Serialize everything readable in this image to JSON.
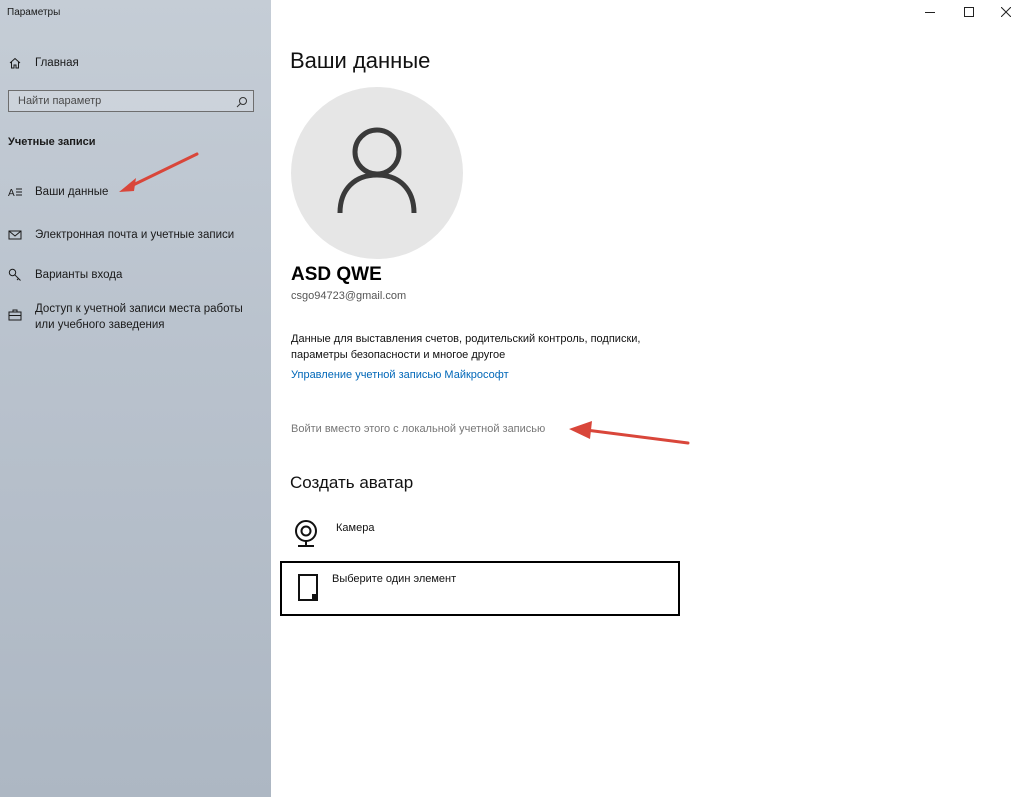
{
  "window": {
    "title": "Параметры",
    "controls": [
      "minimize-icon",
      "maximize-icon",
      "close-icon"
    ]
  },
  "sidebar": {
    "home": {
      "label": "Главная",
      "icon": "home-icon"
    },
    "search": {
      "placeholder": "Найти параметр",
      "value": "",
      "icon": "search-icon"
    },
    "section_heading": "Учетные записи",
    "items": [
      {
        "label": "Ваши данные",
        "icon": "person-info-icon",
        "selected": true
      },
      {
        "label": "Электронная почта и учетные записи",
        "icon": "mail-icon"
      },
      {
        "label": "Варианты входа",
        "icon": "key-icon"
      },
      {
        "label": "Доступ к учетной записи места работы или учебного заведения",
        "icon": "briefcase-icon"
      }
    ]
  },
  "main": {
    "title": "Ваши данные",
    "avatar_icon": "person-icon",
    "user": {
      "name": "ASD QWE",
      "email": "csgo94723@gmail.com"
    },
    "description": "Данные для выставления счетов, родительский контроль, подписки, параметры безопасности и многое другое",
    "manage_link": "Управление учетной записью Майкрософт",
    "local_link": "Войти вместо этого с локальной учетной записью",
    "avatar_section": {
      "heading": "Создать аватар",
      "options": [
        {
          "label": "Камера",
          "icon": "camera-icon"
        },
        {
          "label": "Выберите один элемент",
          "icon": "file-icon"
        }
      ]
    }
  },
  "colors": {
    "sidebar_bg": "#b9c2cd",
    "link": "#0067b8",
    "annotation_arrow": "#d9463a"
  }
}
